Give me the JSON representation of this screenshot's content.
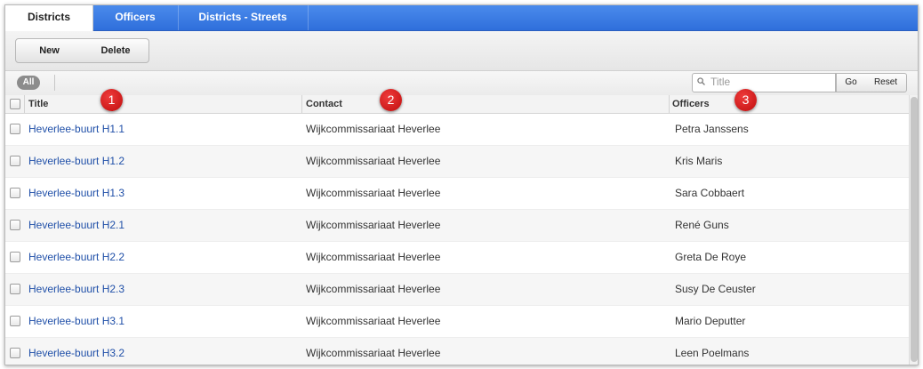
{
  "tabs": [
    {
      "label": "Districts",
      "active": true
    },
    {
      "label": "Officers",
      "active": false
    },
    {
      "label": "Districts - Streets",
      "active": false
    }
  ],
  "toolbar": {
    "new_label": "New",
    "delete_label": "Delete"
  },
  "filter": {
    "all_label": "All"
  },
  "search": {
    "placeholder": "Title",
    "value": "",
    "go_label": "Go",
    "reset_label": "Reset"
  },
  "columns": {
    "title": "Title",
    "contact": "Contact",
    "officers": "Officers"
  },
  "rows": [
    {
      "title": "Heverlee-buurt H1.1",
      "contact": "Wijkcommissariaat Heverlee",
      "officer": "Petra Janssens"
    },
    {
      "title": "Heverlee-buurt H1.2",
      "contact": "Wijkcommissariaat Heverlee",
      "officer": "Kris Maris"
    },
    {
      "title": "Heverlee-buurt H1.3",
      "contact": "Wijkcommissariaat Heverlee",
      "officer": "Sara Cobbaert"
    },
    {
      "title": "Heverlee-buurt H2.1",
      "contact": "Wijkcommissariaat Heverlee",
      "officer": "René Guns"
    },
    {
      "title": "Heverlee-buurt H2.2",
      "contact": "Wijkcommissariaat Heverlee",
      "officer": "Greta De Roye"
    },
    {
      "title": "Heverlee-buurt H2.3",
      "contact": "Wijkcommissariaat Heverlee",
      "officer": "Susy De Ceuster"
    },
    {
      "title": "Heverlee-buurt H3.1",
      "contact": "Wijkcommissariaat Heverlee",
      "officer": "Mario Deputter"
    },
    {
      "title": "Heverlee-buurt H3.2",
      "contact": "Wijkcommissariaat Heverlee",
      "officer": "Leen Poelmans"
    }
  ],
  "annotations": [
    "1",
    "2",
    "3"
  ],
  "icons": {
    "search": "magnifier-icon"
  },
  "colors": {
    "tab_bar": "#2f6fdb",
    "link": "#1f4fa8",
    "badge": "#d41f1f"
  }
}
